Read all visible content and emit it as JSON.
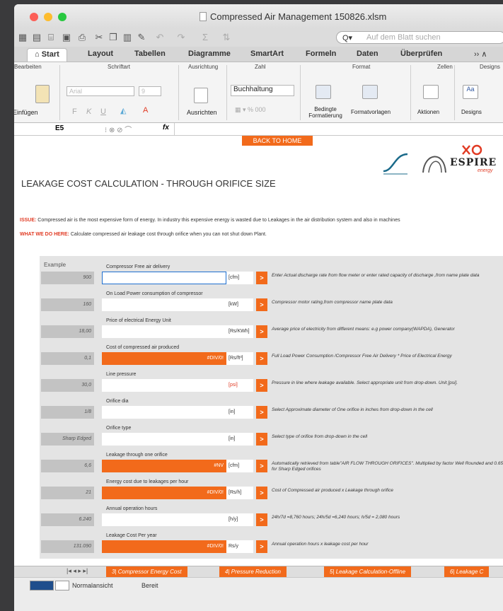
{
  "window": {
    "title": "Compressed Air Management 150826.xlsm"
  },
  "search": {
    "placeholder": "Auf dem Blatt suchen"
  },
  "tabs": [
    "Start",
    "Layout",
    "Tabellen",
    "Diagramme",
    "SmartArt",
    "Formeln",
    "Daten",
    "Überprüfen"
  ],
  "ribbon": {
    "groups": [
      "Bearbeiten",
      "Schriftart",
      "Ausrichtung",
      "Zahl",
      "Format",
      "Zellen",
      "Designs"
    ],
    "einfuegen": "Einfügen",
    "font": "Arial",
    "font_size": "9",
    "ausrichten": "Ausrichten",
    "number_format": "Buchhaltung",
    "bedingte": "Bedingte Formatierung",
    "formatvorlagen": "Formatvorlagen",
    "aktionen": "Aktionen",
    "designs": "Designs"
  },
  "formula_bar": {
    "cell": "E5",
    "fx": "fx"
  },
  "sheet": {
    "back_button": "BACK TO HOME",
    "title": "LEAKAGE COST CALCULATION - THROUGH ORIFICE SIZE",
    "issue_label": "ISSUE:",
    "issue_text": "Compressed air is the most expensive form of energy. In industry this expensive energy is wasted due to Leakages in the air distribution system and also in machines",
    "wedo_label": "WHAT WE DO HERE:",
    "wedo_text": "Calculate compressed air leakage cost through orifice when you can not shut down Plant.",
    "example_label": "Example",
    "logo_text": "ESPIRE",
    "logo_sub": "energy",
    "rows": [
      {
        "label": "Compressor Free air delivery",
        "example": "900",
        "value": "",
        "unit": "[cfm]",
        "desc": "Enter Actual discharge rate from flow meter or enter rated capacity of discharge ,from name plate data",
        "orange": false
      },
      {
        "label": "On Load Power consumption of compressor",
        "example": "160",
        "value": "",
        "unit": "[kW]",
        "desc": "Compressor motor rating,from compressor name plate data",
        "orange": false
      },
      {
        "label": "Price of electrical Energy Unit",
        "example": "18,00",
        "value": "",
        "unit": "[Rs/KWh]",
        "desc": "Average price of electricity from different means: e.g power company(WAPDA), Generator",
        "orange": false
      },
      {
        "label": "Cost of compressed air  produced",
        "example": "0,1",
        "value": "#DIV/0!",
        "unit": "[Rs/ft³]",
        "desc": "Full Load Power Consumption /Compressor Free Air Delivery * Price of Electrical Energy",
        "orange": true
      },
      {
        "label": "Line pressure",
        "example": "30,0",
        "value": "",
        "unit": "[psi]",
        "desc": "Pressure in line where leakage available. Select appropriate unit from drop-down. Unit [psi].",
        "orange": false
      },
      {
        "label": "Orifice dia",
        "example": "1/8",
        "value": "",
        "unit": "[in]",
        "desc": "Select Approximate diameter of One orifice in inches from drop-down in the cell",
        "orange": false
      },
      {
        "label": "Orifice type",
        "example": "Sharp Edged",
        "value": "",
        "unit": "[in]",
        "desc": "Select type of orifice from drop-down in the cell",
        "orange": false
      },
      {
        "label": "Leakage through one orifice",
        "example": "6,6",
        "value": "#NV",
        "unit": "[cfm]",
        "desc": "Automatically retrieved from table\"AIR FLOW THROUGH ORIFICES\". Multiplied by factor Well Rounded and 0.65 for Sharp Edged orifices",
        "orange": true
      },
      {
        "label": "Energy cost due to leakages per hour",
        "example": "21",
        "value": "#DIV/0!",
        "unit": "[Rs/h]",
        "desc": "Cost of Compressed air produced x Leakage through orifice",
        "orange": true
      },
      {
        "label": "Annual operation hours",
        "example": "6.240",
        "value": "",
        "unit": "[h/y]",
        "desc": "24h/7d =8,760 hours; 24h/5d =6,240 hours; h/5d = 2,080 hours",
        "orange": false
      },
      {
        "label": "Leakage Cost Per year",
        "example": "131.090",
        "value": "#DIV/0!",
        "unit": "Rs/y",
        "desc": "Annual operation hours x leakage cost per hour",
        "orange": true
      }
    ]
  },
  "sheet_tabs": [
    "3| Compressor Energy Cost",
    "4| Pressure Reduction",
    "5| Leakage Calculation-Offline",
    "6| Leakage C"
  ],
  "status": {
    "view": "Normalansicht",
    "state": "Bereit"
  },
  "colors": {
    "accent": "#f26a1b",
    "red": "#e13b24"
  }
}
